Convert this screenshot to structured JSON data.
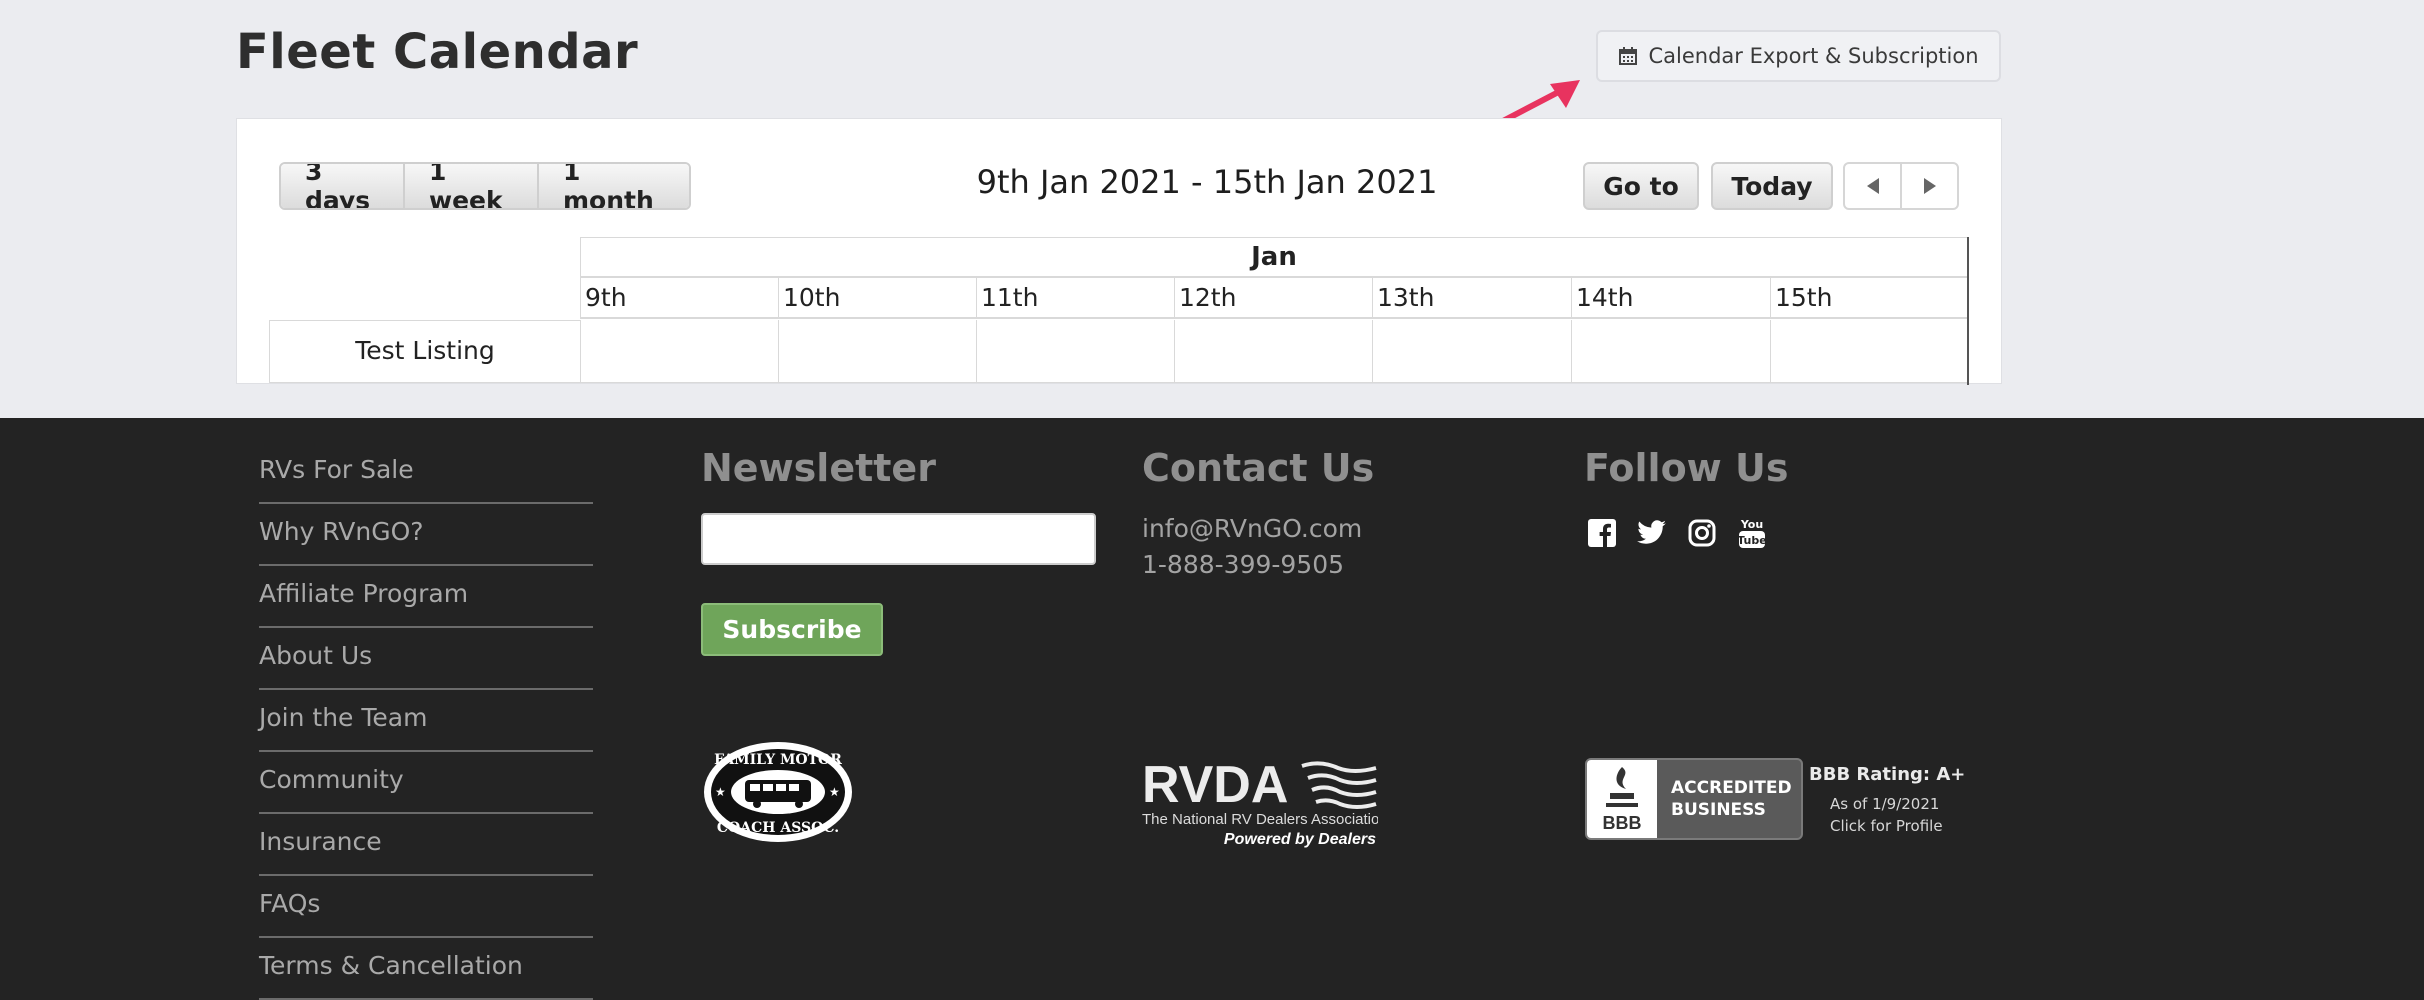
{
  "page": {
    "title": "Fleet Calendar"
  },
  "export": {
    "label": "Calendar Export & Subscription",
    "icon": "calendar-icon"
  },
  "calendar": {
    "view_buttons": [
      "3 days",
      "1 week",
      "1 month"
    ],
    "range_label": "9th Jan 2021 - 15th Jan 2021",
    "goto_label": "Go to",
    "today_label": "Today",
    "prev_icon": "triangle-left-icon",
    "next_icon": "triangle-right-icon",
    "month": "Jan",
    "days": [
      "9th",
      "10th",
      "11th",
      "12th",
      "13th",
      "14th",
      "15th"
    ],
    "rows": [
      "Test Listing"
    ]
  },
  "footer": {
    "links": [
      "RVs For Sale",
      "Why RVnGO?",
      "Affiliate Program",
      "About Us",
      "Join the Team",
      "Community",
      "Insurance",
      "FAQs",
      "Terms & Cancellation Policy"
    ],
    "newsletter": {
      "heading": "Newsletter",
      "input_value": "",
      "button": "Subscribe"
    },
    "contact": {
      "heading": "Contact Us",
      "email": "info@RVnGO.com",
      "phone": "1-888-399-9505"
    },
    "follow": {
      "heading": "Follow Us",
      "icons": [
        "facebook-icon",
        "twitter-icon",
        "instagram-icon",
        "youtube-icon"
      ]
    },
    "badges": {
      "fmca": {
        "top": "FAMILY MOTOR",
        "bottom": "COACH ASSOC."
      },
      "rvda": {
        "name": "RVDA",
        "line1": "The National RV Dealers Association",
        "line2": "Powered by Dealers"
      },
      "bbb": {
        "seal": "BBB",
        "word1": "ACCREDITED",
        "word2": "BUSINESS",
        "rating": "BBB Rating: A+",
        "as_of": "As of 1/9/2021",
        "profile": "Click for Profile"
      }
    }
  },
  "colors": {
    "accent_arrow": "#e8335f",
    "subscribe": "#6fa55a",
    "footer_bg": "#232323"
  }
}
